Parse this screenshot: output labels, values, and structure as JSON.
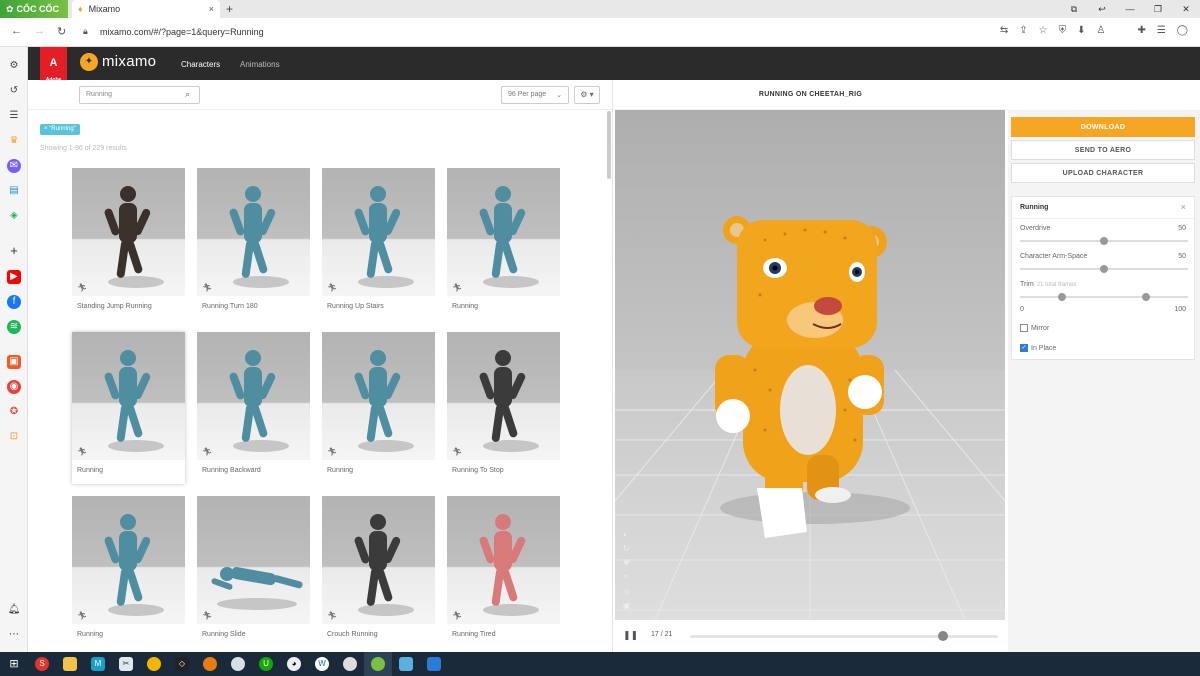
{
  "browser": {
    "brand": "CỐC CỐC",
    "tab_title": "Mixamo",
    "tab_close": "×",
    "new_tab": "+",
    "url": "mixamo.com/#/?page=1&query=Running"
  },
  "header": {
    "adobe_label": "A",
    "adobe_sub": "Adobe",
    "brand": "mixamo",
    "nav": [
      "Characters",
      "Animations"
    ]
  },
  "library": {
    "search_value": "Running",
    "per_page": "96 Per page",
    "filter_chip": "× \"Running\"",
    "results_text": "Showing 1-96 of 229 results",
    "cards": [
      {
        "label": "Standing Jump Running",
        "figure": "dark"
      },
      {
        "label": "Running Turn 180",
        "figure": "teal"
      },
      {
        "label": "Running Up Stairs",
        "figure": "teal"
      },
      {
        "label": "Running",
        "figure": "teal"
      },
      {
        "label": "Running",
        "figure": "teal",
        "selected": true
      },
      {
        "label": "Running Backward",
        "figure": "teal"
      },
      {
        "label": "Running",
        "figure": "teal"
      },
      {
        "label": "Running To Stop",
        "figure": "soldier"
      },
      {
        "label": "Running",
        "figure": "teal"
      },
      {
        "label": "Running Slide",
        "figure": "teal-lying"
      },
      {
        "label": "Crouch Running",
        "figure": "soldier"
      },
      {
        "label": "Running Tired",
        "figure": "pink"
      }
    ]
  },
  "viewer": {
    "title": "RUNNING ON CHEETAH_RIG",
    "frame": "17 / 21",
    "playhead_fraction": 0.82
  },
  "actions": {
    "download": "DOWNLOAD",
    "send_to_aero": "SEND TO AERO",
    "upload_character": "UPLOAD CHARACTER"
  },
  "settings": {
    "title": "Running",
    "overdrive_label": "Overdrive",
    "overdrive_value": "50",
    "overdrive_level": 0.5,
    "armspace_label": "Character Arm-Space",
    "armspace_value": "50",
    "armspace_level": 0.5,
    "trim_label": "Trim",
    "trim_sub": "21 total frames",
    "trim_min": "0",
    "trim_max": "100",
    "trim_start_level": 0.25,
    "trim_end_level": 0.75,
    "mirror_label": "Mirror",
    "mirror_checked": false,
    "inplace_label": "In Place",
    "inplace_checked": true
  },
  "colors": {
    "accent": "#f6a623",
    "header_bg": "#2b2b2b",
    "chip": "#59c3d8",
    "adobe_red": "#e41e26"
  }
}
